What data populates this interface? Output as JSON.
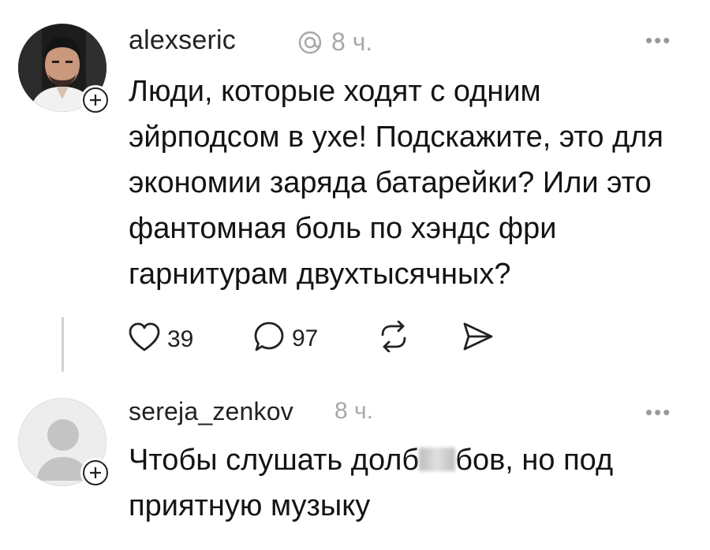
{
  "post": {
    "username": "alexseric",
    "time": "8 ч.",
    "more": "•••",
    "lines": [
      "Люди, которые ходят с одним",
      "эйрподсом в ухе! Подскажите, это для",
      "экономии заряда батарейки? Или это",
      "фантомная боль по хэндс фри",
      "гарнитурам двухтысячных?"
    ],
    "likes": "39",
    "replies": "97",
    "icons": [
      "heart-icon",
      "comment-icon",
      "repost-icon",
      "send-icon",
      "threads-icon",
      "add-icon"
    ]
  },
  "reply": {
    "username": "sereja_zenkov",
    "time": "8 ч.",
    "more": "•••",
    "line1_before": "Чтобы слушать долб",
    "line1_after": "бов, но под",
    "line2": "приятную музыку"
  }
}
